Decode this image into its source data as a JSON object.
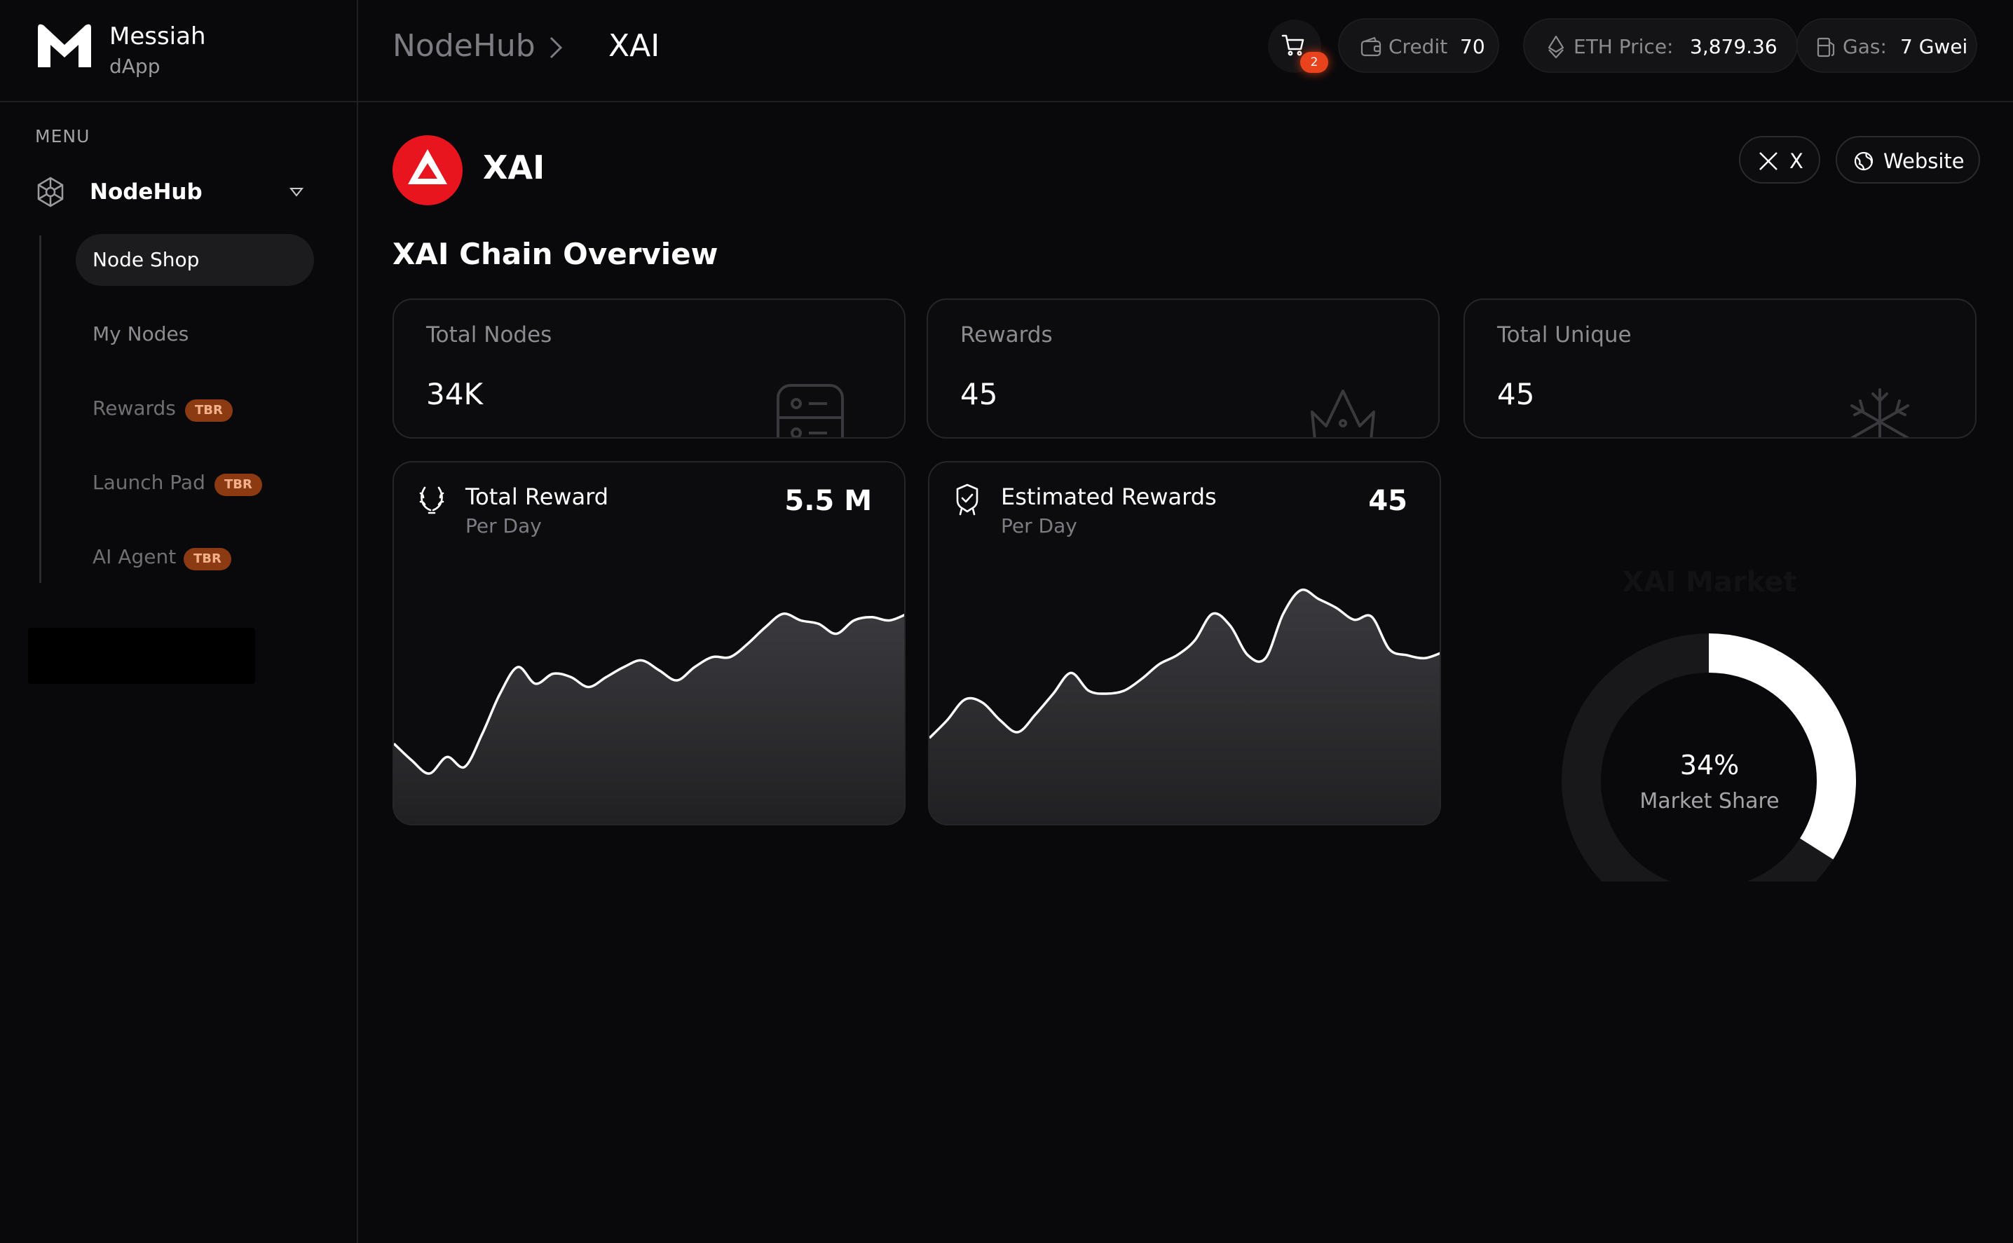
{
  "brand": {
    "name": "Messiah",
    "sub": "dApp"
  },
  "sidebar": {
    "menu_label": "MENU",
    "parent": {
      "label": "NodeHub",
      "icon": "network-hub-icon"
    },
    "items": [
      {
        "label": "Node Shop",
        "active": true,
        "badge": ""
      },
      {
        "label": "My Nodes",
        "active": false,
        "badge": ""
      },
      {
        "label": "Rewards",
        "active": false,
        "badge": "TBR"
      },
      {
        "label": "Launch Pad",
        "active": false,
        "badge": "TBR"
      },
      {
        "label": "AI Agent",
        "active": false,
        "badge": "TBR"
      }
    ]
  },
  "header": {
    "breadcrumb": [
      "NodeHub",
      "XAI"
    ],
    "cart_count": "2",
    "credit": {
      "label": "Credit",
      "value": "70"
    },
    "eth": {
      "label": "ETH Price:",
      "value": "3,879.36"
    },
    "gas": {
      "label": "Gas:",
      "value": "7 Gwei"
    }
  },
  "token": {
    "name": "XAI",
    "links": {
      "x": "X",
      "website": "Website"
    },
    "brand_color": "#e8151f"
  },
  "overview": {
    "title": "XAI Chain Overview",
    "stats": [
      {
        "label": "Total Nodes",
        "value": "34K",
        "icon": "server-icon"
      },
      {
        "label": "Rewards",
        "value": "45",
        "icon": "crown-icon"
      },
      {
        "label": "Total Unique",
        "value": "45",
        "icon": "snowflake-icon"
      }
    ],
    "charts": [
      {
        "title": "Total Reward",
        "sub": "Per Day",
        "value": "5.5 M",
        "icon": "laurel-icon"
      },
      {
        "title": "Estimated Rewards",
        "sub": "Per Day",
        "value": "45",
        "icon": "badge-check-icon"
      }
    ],
    "market": {
      "title": "XAI Market",
      "percent_text": "34%",
      "caption": "Market Share",
      "share": 0.34
    }
  },
  "chart_data": [
    {
      "type": "area",
      "title": "Total Reward",
      "x": [
        0,
        1,
        2,
        3,
        4,
        5,
        6,
        7,
        8,
        9,
        10,
        11,
        12,
        13,
        14,
        15,
        16,
        17,
        18,
        19,
        20,
        21,
        22,
        23,
        24,
        25,
        26,
        27,
        28,
        29
      ],
      "values": [
        25,
        20,
        16,
        21,
        18,
        28,
        40,
        48,
        43,
        46,
        45,
        42,
        45,
        48,
        50,
        47,
        44,
        48,
        51,
        51,
        55,
        60,
        64,
        62,
        61,
        58,
        62,
        63,
        62,
        64
      ],
      "ylim": [
        0,
        80
      ]
    },
    {
      "type": "area",
      "title": "Estimated Rewards",
      "x": [
        0,
        1,
        2,
        3,
        4,
        5,
        6,
        7,
        8,
        9,
        10,
        11,
        12,
        13,
        14,
        15,
        16,
        17,
        18,
        19,
        20,
        21,
        22,
        23,
        24,
        25,
        26,
        27,
        28,
        29
      ],
      "values": [
        30,
        36,
        43,
        42,
        36,
        32,
        38,
        45,
        52,
        46,
        45,
        46,
        50,
        55,
        58,
        63,
        72,
        68,
        58,
        57,
        72,
        80,
        77,
        74,
        70,
        71,
        60,
        58,
        57,
        59
      ],
      "ylim": [
        0,
        90
      ]
    }
  ]
}
